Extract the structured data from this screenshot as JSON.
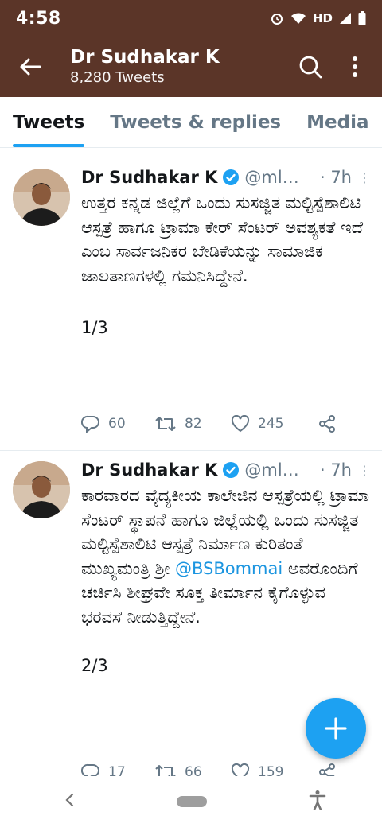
{
  "status_bar": {
    "time": "4:58",
    "network": "HD"
  },
  "header": {
    "title": "Dr Sudhakar K",
    "subtitle": "8,280 Tweets",
    "back_icon": "arrow-left-icon",
    "search_icon": "search-icon",
    "menu_icon": "more-vertical-icon"
  },
  "tabs": [
    {
      "label": "Tweets",
      "active": true
    },
    {
      "label": "Tweets & replies",
      "active": false
    },
    {
      "label": "Media",
      "active": false
    }
  ],
  "tweets": [
    {
      "name": "Dr Sudhakar K",
      "handle": "@ml…",
      "time": "· 7h",
      "text": "ಉತ್ತರ ಕನ್ನಡ ಜಿಲ್ಲೆಗೆ ಒಂದು ಸುಸಜ್ಜಿತ ಮಲ್ಟಿಸ್ಪೆಶಾಲಿಟಿ ಆಸ್ಪತ್ರೆ ಹಾಗೂ ಟ್ರಾಮಾ ಕೇರ್ ಸೆಂಟರ್ ಅವಶ್ಯಕತೆ ಇದೆ ಎಂಬ ಸಾರ್ವಜನಿಕರ ಬೇಡಿಕೆಯನ್ನು ಸಾಮಾಜಿಕ ಜಾಲತಾಣಗಳಲ್ಲಿ ಗಮನಿಸಿದ್ದೇನೆ.",
      "thread": "1/3",
      "replies": "60",
      "retweets": "82",
      "likes": "245"
    },
    {
      "name": "Dr Sudhakar K",
      "handle": "@ml…",
      "time": "· 7h",
      "text_before": "ಕಾರವಾರದ ವೈದ್ಯಕೀಯ ಕಾಲೇಜಿನ ಆಸ್ಪತ್ರೆಯಲ್ಲಿ ಟ್ರಾಮಾ ಸೆಂಟರ್ ಸ್ಥಾಪನೆ ಹಾಗೂ ಜಿಲ್ಲೆಯಲ್ಲಿ ಒಂದು ಸುಸಜ್ಜಿತ ಮಲ್ಟಿಸ್ಪೆಶಾಲಿಟಿ ಆಸ್ಪತ್ರೆ ನಿರ್ಮಾಣ ಕುರಿತಂತೆ ಮುಖ್ಯಮಂತ್ರಿ ಶ್ರೀ ",
      "mention": "@BSBommai",
      "text_after": " ಅವರೊಂದಿಗೆ ಚರ್ಚಿಸಿ ಶೀಘ್ರವೇ ಸೂಕ್ತ ತೀರ್ಮಾನ ಕೈಗೊಳ್ಳುವ ಭರವಸೆ ನೀಡುತ್ತಿದ್ದೇನೆ.",
      "thread": "2/3",
      "replies": "17",
      "retweets": "66",
      "likes": "159"
    }
  ],
  "colors": {
    "header_bg": "#5b3528",
    "accent": "#1da1f2",
    "muted": "#657786"
  }
}
